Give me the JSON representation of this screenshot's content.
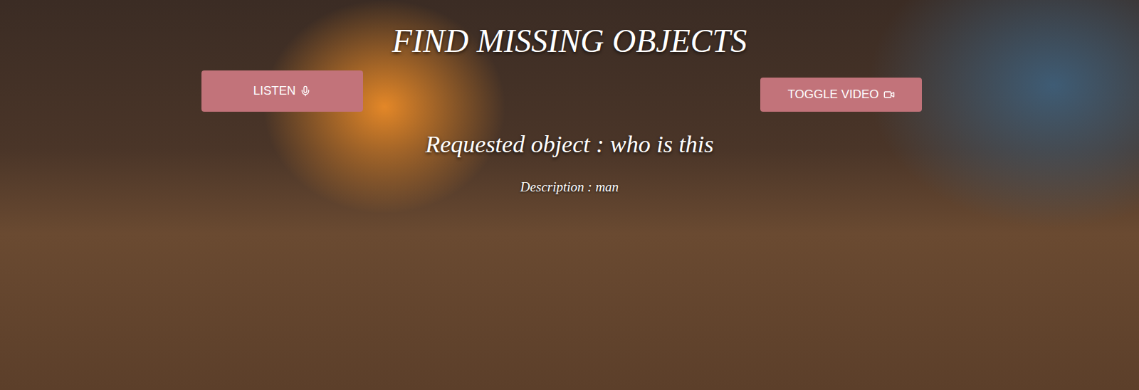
{
  "title": "FIND MISSING OBJECTS",
  "buttons": [
    {
      "label": "LISTEN",
      "kind": "listen"
    },
    {
      "label": "TOGGLE VIDEO",
      "kind": "video"
    }
  ],
  "request": {
    "label": "Requested object : who is this"
  },
  "description": {
    "label": "Description : man"
  }
}
